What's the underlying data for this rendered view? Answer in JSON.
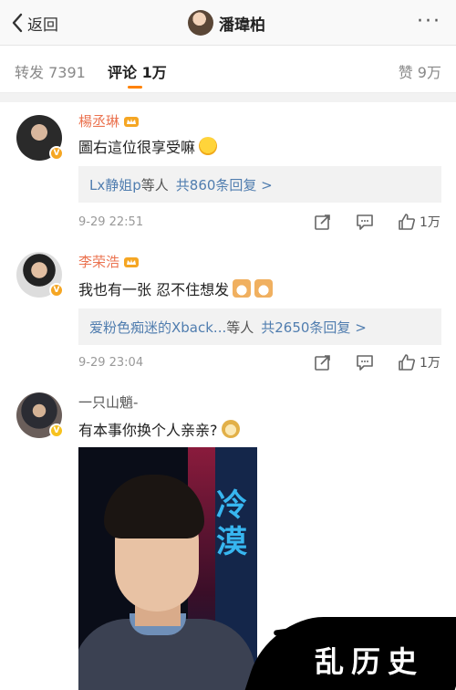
{
  "topbar": {
    "back_label": "返回",
    "title": "潘瑋柏",
    "more_label": "···"
  },
  "tabs": {
    "repost": "转发 7391",
    "comment": "评论 1万",
    "like": "赞 9万",
    "active": "comment",
    "accent_color": "#ff8200"
  },
  "comments": [
    {
      "name": "楊丞琳",
      "name_color": "#eb7350",
      "badge": "v-orange",
      "text": "圖右這位很享受嘛",
      "emoji": "smile-emoji",
      "replies_name": "Lx静姐p",
      "replies_mid": "等人",
      "replies_count": "共860条回复 >",
      "time": "9-29 22:51",
      "likes": "1万"
    },
    {
      "name": "李荣浩",
      "name_color": "#eb7350",
      "badge": "v-orange",
      "text": "我也有一张 忍不住想发",
      "emoji": "cat-emoji",
      "replies_name": "爱粉色痴迷的Xback...",
      "replies_mid": "等人",
      "replies_count": "共2650条回复 >",
      "time": "9-29 23:04",
      "likes": "1万"
    },
    {
      "name": "一只山魈-",
      "name_color": "#555555",
      "badge": "v-yellow",
      "text": "有本事你换个人亲亲?",
      "emoji": "doge-emoji",
      "image_caption": "冷漠"
    }
  ],
  "watermark": "乱历史"
}
